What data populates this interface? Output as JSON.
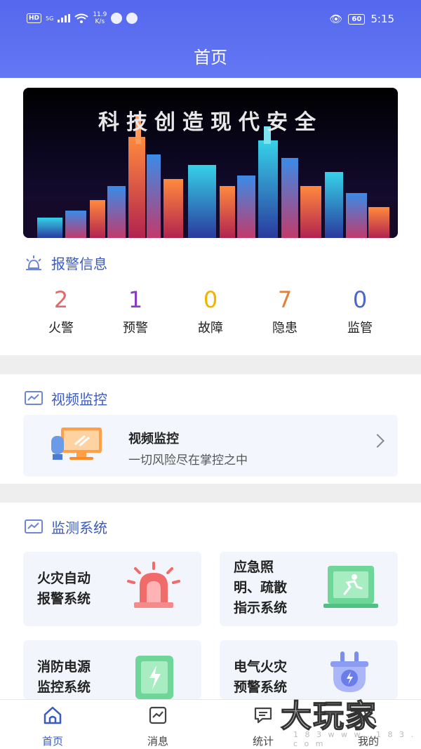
{
  "status_bar": {
    "network": "HD",
    "signal": "5G",
    "speed": "11.9\nK/s",
    "battery": "60",
    "time": "5:15"
  },
  "header": {
    "title": "首页"
  },
  "banner": {
    "text": "科技创造现代安全"
  },
  "alarm_section": {
    "title": "报警信息",
    "stats": [
      {
        "value": "2",
        "label": "火警",
        "color": "#e06a6a"
      },
      {
        "value": "1",
        "label": "预警",
        "color": "#8a3cc7"
      },
      {
        "value": "0",
        "label": "故障",
        "color": "#f0b400"
      },
      {
        "value": "7",
        "label": "隐患",
        "color": "#e5803a"
      },
      {
        "value": "0",
        "label": "监管",
        "color": "#4a67cc"
      }
    ]
  },
  "video_section": {
    "title": "视频监控",
    "card_title": "视频监控",
    "card_subtitle": "一切风险尽在掌控之中"
  },
  "monitor_section": {
    "title": "监测系统",
    "cards": [
      {
        "line1": "火灾自动",
        "line2": "报警系统",
        "line3": ""
      },
      {
        "line1": "应急照",
        "line2": "明、疏散",
        "line3": "指示系统"
      },
      {
        "line1": "消防电源",
        "line2": "监控系统",
        "line3": ""
      },
      {
        "line1": "电气火灾",
        "line2": "预警系统",
        "line3": ""
      }
    ]
  },
  "bottom_nav": [
    {
      "label": "首页",
      "icon": "home-icon"
    },
    {
      "label": "消息",
      "icon": "message-icon"
    },
    {
      "label": "统计",
      "icon": "statistics-icon"
    },
    {
      "label": "我的",
      "icon": "profile-icon"
    }
  ],
  "watermark": {
    "text": "大玩家",
    "url": "1 8 3 w w w . 1 8 3 . c o m"
  },
  "colors": {
    "primary": "#5568ee",
    "accent_text": "#3b5bbf"
  }
}
